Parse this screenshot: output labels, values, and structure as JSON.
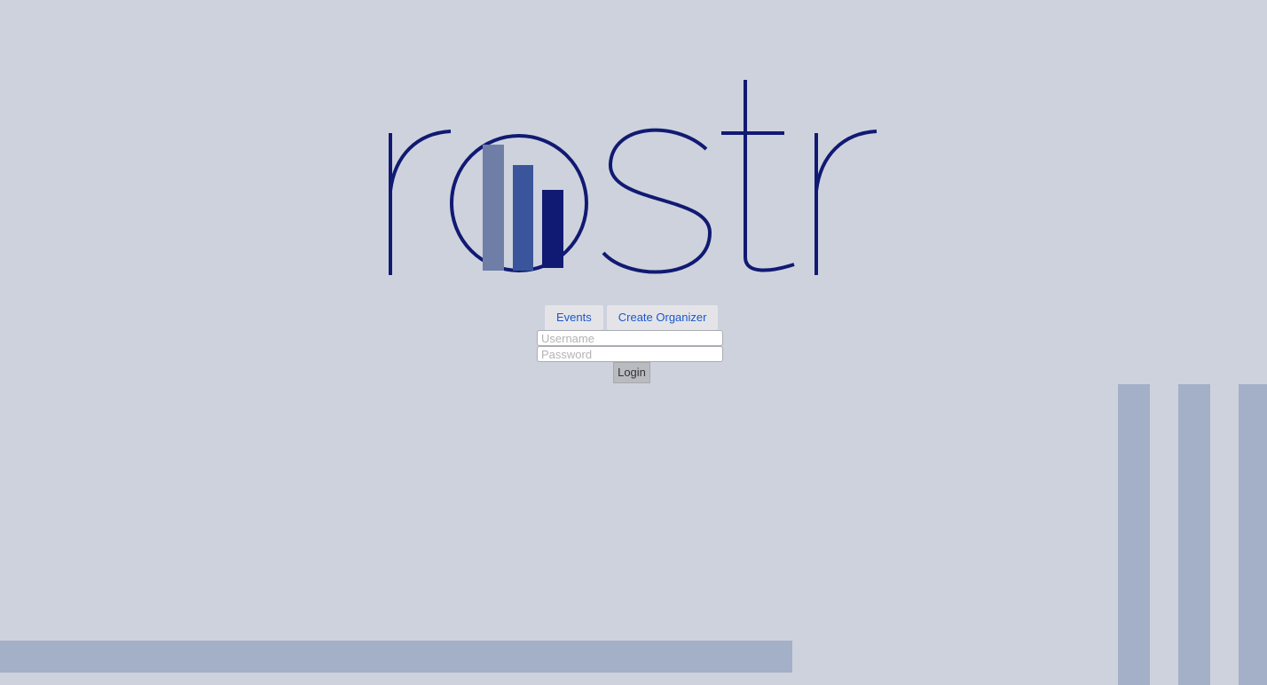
{
  "brand": {
    "name": "rostr",
    "primary_color": "#111a72",
    "bar_colors": [
      "#6f7ea6",
      "#3a559b",
      "#111a72"
    ]
  },
  "nav": {
    "items": [
      {
        "label": "Events"
      },
      {
        "label": "Create Organizer"
      }
    ]
  },
  "login_form": {
    "username": {
      "value": "",
      "placeholder": "Username"
    },
    "password": {
      "value": "",
      "placeholder": "Password"
    },
    "submit_label": "Login"
  },
  "colors": {
    "background": "#ced2dd",
    "decor_bars": "#a4afc8",
    "link": "#1a57c8"
  }
}
